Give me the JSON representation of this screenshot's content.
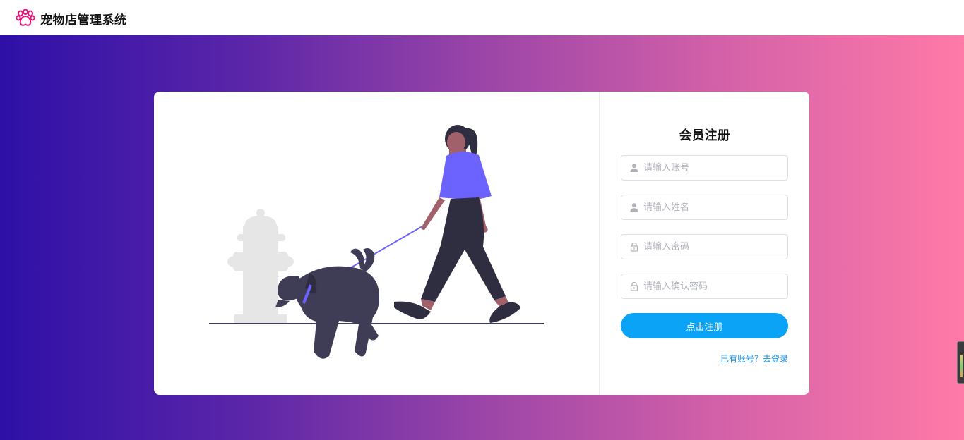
{
  "header": {
    "app_title": "宠物店管理系统",
    "logo_icon": "paw-icon",
    "logo_color": "#e8157a"
  },
  "register": {
    "title": "会员注册",
    "fields": [
      {
        "name": "account",
        "icon": "user-icon",
        "placeholder": "请输入账号",
        "value": ""
      },
      {
        "name": "realname",
        "icon": "user-icon",
        "placeholder": "请输入姓名",
        "value": ""
      },
      {
        "name": "password",
        "icon": "lock-icon",
        "placeholder": "请输入密码",
        "value": ""
      },
      {
        "name": "confirm",
        "icon": "lock-icon",
        "placeholder": "请输入确认密码",
        "value": ""
      }
    ],
    "submit_label": "点击注册",
    "login_link": "已有账号？去登录"
  },
  "colors": {
    "gradient_start": "#2e10a7",
    "gradient_end": "#ff7aa7",
    "button": "#0aa3f5",
    "link": "#1a8fe0",
    "accent_purple": "#6c63ff"
  }
}
